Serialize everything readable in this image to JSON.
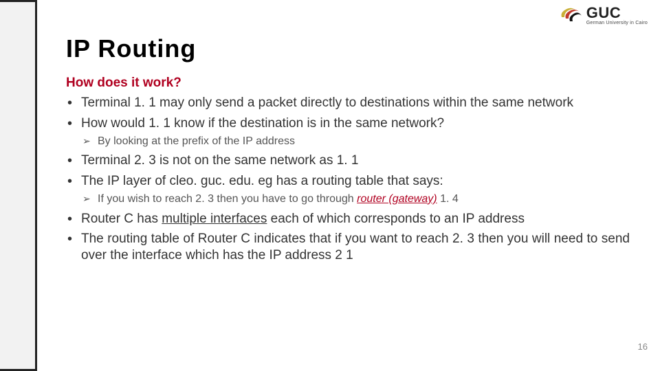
{
  "logo": {
    "main": "GUC",
    "sub": "German University in Cairo"
  },
  "title": "IP Routing",
  "subtitle": "How does it work?",
  "bullets": [
    {
      "text": "Terminal 1. 1 may only send a packet directly to destinations within the same network"
    },
    {
      "text": "How would 1. 1 know if the destination is in the same network?",
      "sub": [
        {
          "text": "By looking at the prefix of the IP address"
        }
      ]
    },
    {
      "text": "Terminal 2. 3 is not on the same network as 1. 1"
    },
    {
      "text": "The IP layer of cleo. guc. edu. eg has a routing table that says:",
      "sub": [
        {
          "prefix": "If you wish to reach 2. 3 then you have to go through ",
          "emph": "router (gateway)",
          "suffix": " 1. 4"
        }
      ]
    },
    {
      "html": "Router C has <span class=\"underline\">multiple interfaces</span> each of which corresponds to an IP address"
    },
    {
      "text": "The routing table of Router C indicates that if you want to reach 2. 3 then you will need to send over the interface which has the IP address 2 1"
    }
  ],
  "page_number": "16"
}
